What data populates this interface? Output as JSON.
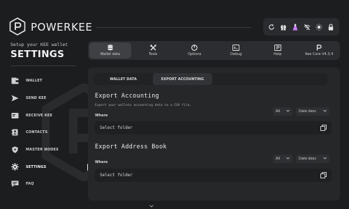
{
  "app": {
    "brand": "POWERKEE"
  },
  "toolbar": {
    "icons": [
      "refresh-icon",
      "gift-icon",
      "flask-icon",
      "no-signal-icon",
      "brightness-icon",
      "lock-icon"
    ]
  },
  "sidebar": {
    "subtitle": "Setup your KEE wallet",
    "heading": "SETTINGS",
    "items": [
      {
        "label": "WALLET",
        "icon": "wallet-icon"
      },
      {
        "label": "SEND KEE",
        "icon": "send-icon"
      },
      {
        "label": "RECEIVE KEE",
        "icon": "receive-icon"
      },
      {
        "label": "CONTACTS",
        "icon": "contacts-icon"
      },
      {
        "label": "MASTER NODES",
        "icon": "shield-icon"
      },
      {
        "label": "SETTINGS",
        "icon": "gear-icon"
      },
      {
        "label": "FAQ",
        "icon": "faq-icon"
      }
    ],
    "active_index": 5
  },
  "tabs": [
    {
      "label": "Wallet data",
      "icon": "database-icon",
      "active": true
    },
    {
      "label": "Tools",
      "icon": "tools-icon",
      "active": false
    },
    {
      "label": "Options",
      "icon": "options-icon",
      "active": false
    },
    {
      "label": "Debug",
      "icon": "terminal-icon",
      "active": false
    },
    {
      "label": "Help",
      "icon": "help-icon",
      "active": false
    },
    {
      "label": "Kee Core V4.3.4",
      "icon": "kee-core-icon",
      "active": false
    }
  ],
  "subtabs": [
    {
      "label": "WALLET DATA",
      "active": false
    },
    {
      "label": "EXPORT ACCOUNTING",
      "active": true
    }
  ],
  "export_accounting": {
    "title": "Export Accounting",
    "description": "Export your wallets accounting data to a CSV file.",
    "where_label": "Where",
    "filter_value": "All",
    "sort_value": "Date desc",
    "folder_placeholder": "Select folder"
  },
  "export_address_book": {
    "title": "Export Address Book",
    "where_label": "Where",
    "filter_value": "All",
    "sort_value": "Date desc",
    "folder_placeholder": "Select folder"
  },
  "colors": {
    "background": "#1c1d1f",
    "panel": "#262729",
    "accent": "#ffffff",
    "flask": "#c77dff"
  }
}
